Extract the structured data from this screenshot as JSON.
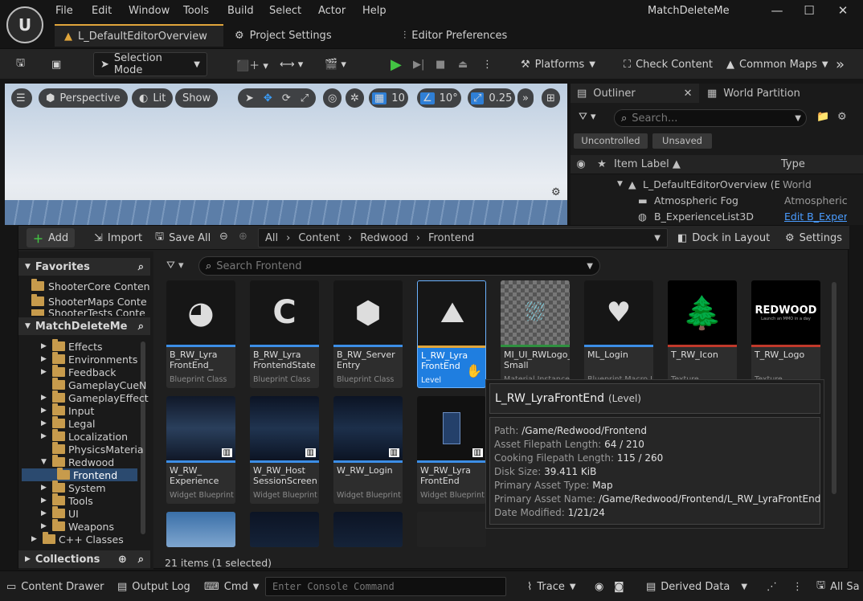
{
  "window": {
    "app_logo": "unreal-engine-logo",
    "project_name": "MatchDeleteMe",
    "menus": [
      "File",
      "Edit",
      "Window",
      "Tools",
      "Build",
      "Select",
      "Actor",
      "Help"
    ],
    "tabs": [
      "L_DefaultEditorOverview",
      "Project Settings",
      "Editor Preferences"
    ]
  },
  "toolbar": {
    "selection_mode": "Selection Mode",
    "platforms": "Platforms",
    "check_content": "Check Content",
    "common_maps": "Common Maps"
  },
  "viewport": {
    "perspective": "Perspective",
    "lit": "Lit",
    "show": "Show",
    "grid_snap": "10",
    "rotate_snap": "10°",
    "scale_snap": "0.25"
  },
  "outliner": {
    "tab": "Outliner",
    "tab2": "World Partition",
    "search_placeholder": "Search...",
    "filters": [
      "Uncontrolled",
      "Unsaved"
    ],
    "col_label": "Item Label",
    "col_type": "Type",
    "rows": [
      {
        "label": "L_DefaultEditorOverview (Ed",
        "type": "World"
      },
      {
        "label": "Atmospheric Fog",
        "type": "Atmospheric"
      },
      {
        "label": "B_ExperienceList3D",
        "type": "Edit B_Experi"
      }
    ]
  },
  "drawer": {
    "add": "Add",
    "import": "Import",
    "save_all": "Save All",
    "breadcrumb": [
      "All",
      "Content",
      "Redwood",
      "Frontend"
    ],
    "dock": "Dock in Layout",
    "settings": "Settings",
    "search_placeholder": "Search Frontend",
    "favorites_title": "Favorites",
    "favorites": [
      "ShooterCore Conten",
      "ShooterMaps Conte",
      "ShooterTests Conte"
    ],
    "project_title": "MatchDeleteMe",
    "tree": [
      "Effects",
      "Environments",
      "Feedback",
      "GameplayCueN",
      "GameplayEffect",
      "Input",
      "Legal",
      "Localization",
      "PhysicsMateria",
      "Redwood",
      "Frontend",
      "System",
      "Tools",
      "UI",
      "Weapons",
      "C++ Classes"
    ],
    "collections": "Collections",
    "status": "21 items (1 selected)",
    "assets": [
      {
        "name": "B_RW_Lyra FrontEnd_",
        "type": "Blueprint Class"
      },
      {
        "name": "B_RW_Lyra FrontendState",
        "type": "Blueprint Class"
      },
      {
        "name": "B_RW_Server Entry",
        "type": "Blueprint Class"
      },
      {
        "name": "L_RW_Lyra FrontEnd",
        "type": "Level"
      },
      {
        "name": "MI_UI_RWLogo_ Small",
        "type": "Material Instance"
      },
      {
        "name": "ML_Login",
        "type": "Blueprint Macro L"
      },
      {
        "name": "T_RW_Icon",
        "type": "Texture"
      },
      {
        "name": "T_RW_Logo",
        "type": "Texture"
      },
      {
        "name": "W_RW_ Experience",
        "type": "Widget Blueprint"
      },
      {
        "name": "W_RW_Host SessionScreen",
        "type": "Widget Blueprint"
      },
      {
        "name": "W_RW_Login",
        "type": "Widget Blueprint"
      },
      {
        "name": "W_RW_Lyra FrontEnd",
        "type": "Widget Blueprint"
      }
    ],
    "logo_text": "REDWOOD",
    "logo_sub": "Launch an MMO in a day"
  },
  "tooltip": {
    "title": "L_RW_LyraFrontEnd",
    "kind": "(Level)",
    "lines": [
      {
        "k": "Path:",
        "v": "/Game/Redwood/Frontend"
      },
      {
        "k": "Asset Filepath Length:",
        "v": "64 / 210"
      },
      {
        "k": "Cooking Filepath Length:",
        "v": "115 / 260"
      },
      {
        "k": "Disk Size:",
        "v": "39.411 KiB"
      },
      {
        "k": "Primary Asset Type:",
        "v": "Map"
      },
      {
        "k": "Primary Asset Name:",
        "v": "/Game/Redwood/Frontend/L_RW_LyraFrontEnd"
      },
      {
        "k": "Date Modified:",
        "v": "1/21/24"
      }
    ]
  },
  "statusbar": {
    "content_drawer": "Content Drawer",
    "output_log": "Output Log",
    "cmd": "Cmd",
    "console_placeholder": "Enter Console Command",
    "trace": "Trace",
    "derived_data": "Derived Data",
    "all_saved": "All Sa"
  }
}
